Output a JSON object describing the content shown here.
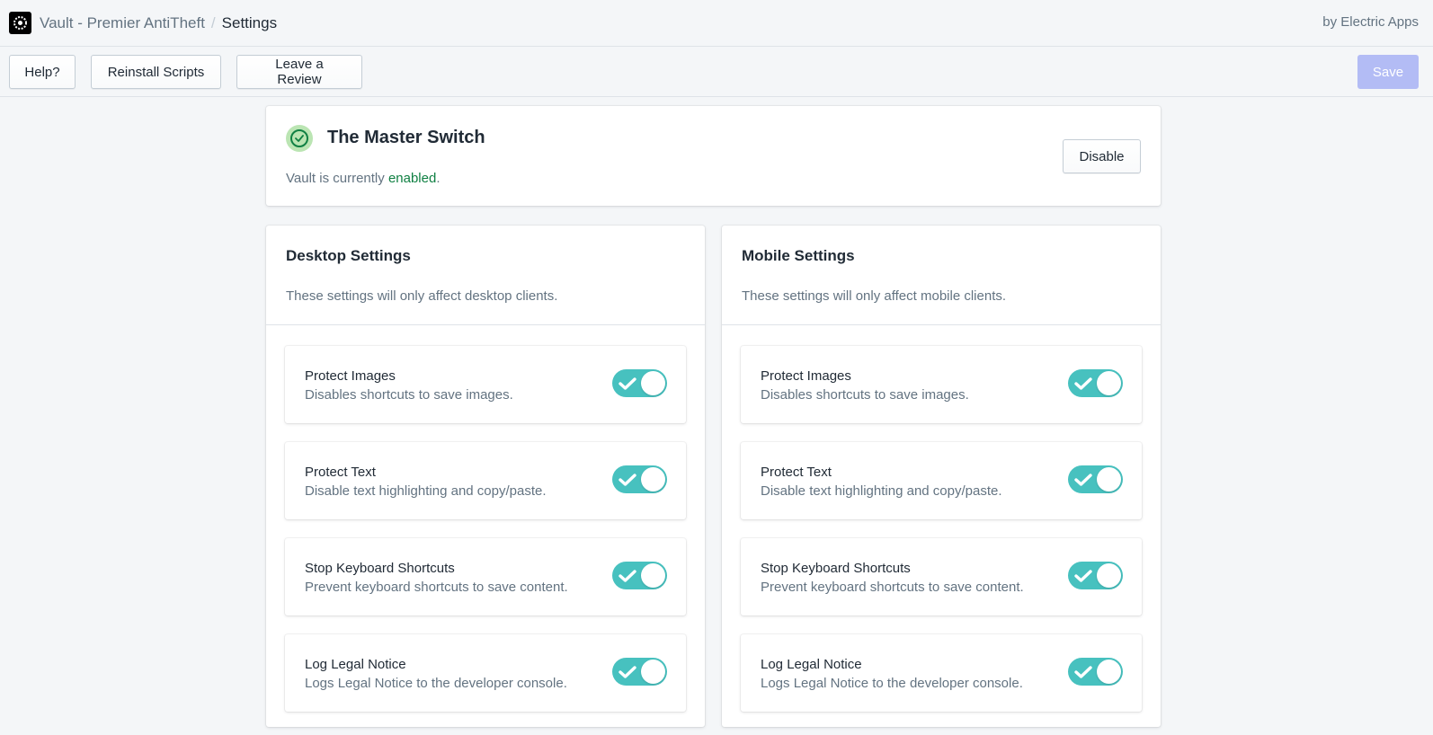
{
  "header": {
    "app_name": "Vault - Premier AntiTheft",
    "separator": "/",
    "current_page": "Settings",
    "brand": "by Electric Apps"
  },
  "toolbar": {
    "help_label": "Help?",
    "reinstall_label": "Reinstall Scripts",
    "review_label": "Leave a Review",
    "save_label": "Save"
  },
  "master": {
    "title": "The Master Switch",
    "status_prefix": "Vault is currently ",
    "status_value": "enabled",
    "status_suffix": ".",
    "disable_label": "Disable"
  },
  "desktop": {
    "title": "Desktop Settings",
    "description": "These settings will only affect desktop clients.",
    "options": [
      {
        "title": "Protect Images",
        "description": "Disables shortcuts to save images.",
        "enabled": true
      },
      {
        "title": "Protect Text",
        "description": "Disable text highlighting and copy/paste.",
        "enabled": true
      },
      {
        "title": "Stop Keyboard Shortcuts",
        "description": "Prevent keyboard shortcuts to save content.",
        "enabled": true
      },
      {
        "title": "Log Legal Notice",
        "description": "Logs Legal Notice to the developer console.",
        "enabled": true
      }
    ]
  },
  "mobile": {
    "title": "Mobile Settings",
    "description": "These settings will only affect mobile clients.",
    "options": [
      {
        "title": "Protect Images",
        "description": "Disables shortcuts to save images.",
        "enabled": true
      },
      {
        "title": "Protect Text",
        "description": "Disable text highlighting and copy/paste.",
        "enabled": true
      },
      {
        "title": "Stop Keyboard Shortcuts",
        "description": "Prevent keyboard shortcuts to save content.",
        "enabled": true
      },
      {
        "title": "Log Legal Notice",
        "description": "Logs Legal Notice to the developer console.",
        "enabled": true
      }
    ]
  },
  "colors": {
    "toggle_on": "#47c1bf",
    "enabled_text": "#108043",
    "save_disabled": "#b3bcf5",
    "background": "#f4f6f8"
  },
  "icons": {
    "logo": "vault-logo-icon",
    "status": "check-circle-icon",
    "toggle": "checkmark-icon"
  }
}
